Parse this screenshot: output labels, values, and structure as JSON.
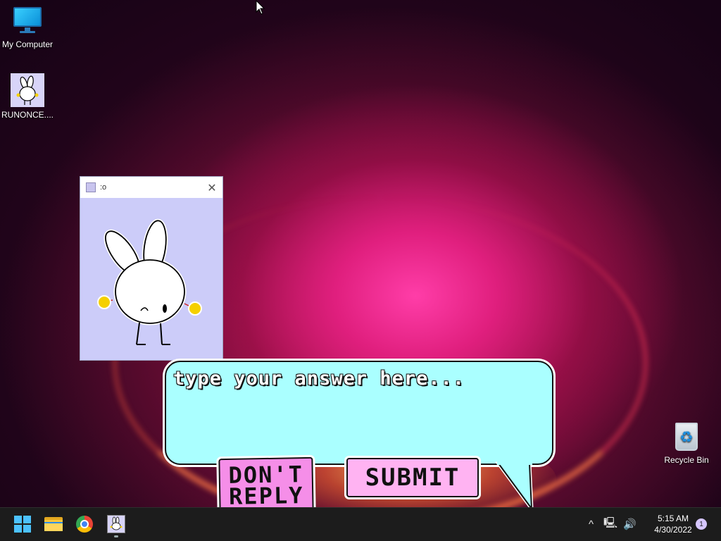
{
  "desktop": {
    "icons": [
      {
        "label": "My Computer",
        "icon": "monitor-icon"
      },
      {
        "label": "RUNONCE....",
        "icon": "bunny-app-icon"
      },
      {
        "label": "Recycle Bin",
        "icon": "recycle-bin-icon"
      }
    ]
  },
  "app_window": {
    "title": ":o",
    "close_icon": "close-icon"
  },
  "dialog": {
    "answer_placeholder": "type your answer here...",
    "dont_reply_label": "DON'T REPLY",
    "submit_label": "SUBMIT"
  },
  "taskbar": {
    "apps": [
      "start-icon",
      "file-explorer-icon",
      "chrome-icon",
      "bunny-app-icon"
    ],
    "clock_time": "5:15 AM",
    "clock_date": "4/30/2022",
    "notification_count": "1"
  },
  "colors": {
    "bubble_fill": "#aaffff",
    "button_fill": "#ffb3f2",
    "window_fill": "#ccccf9",
    "taskbar": "#1c1c1c"
  }
}
